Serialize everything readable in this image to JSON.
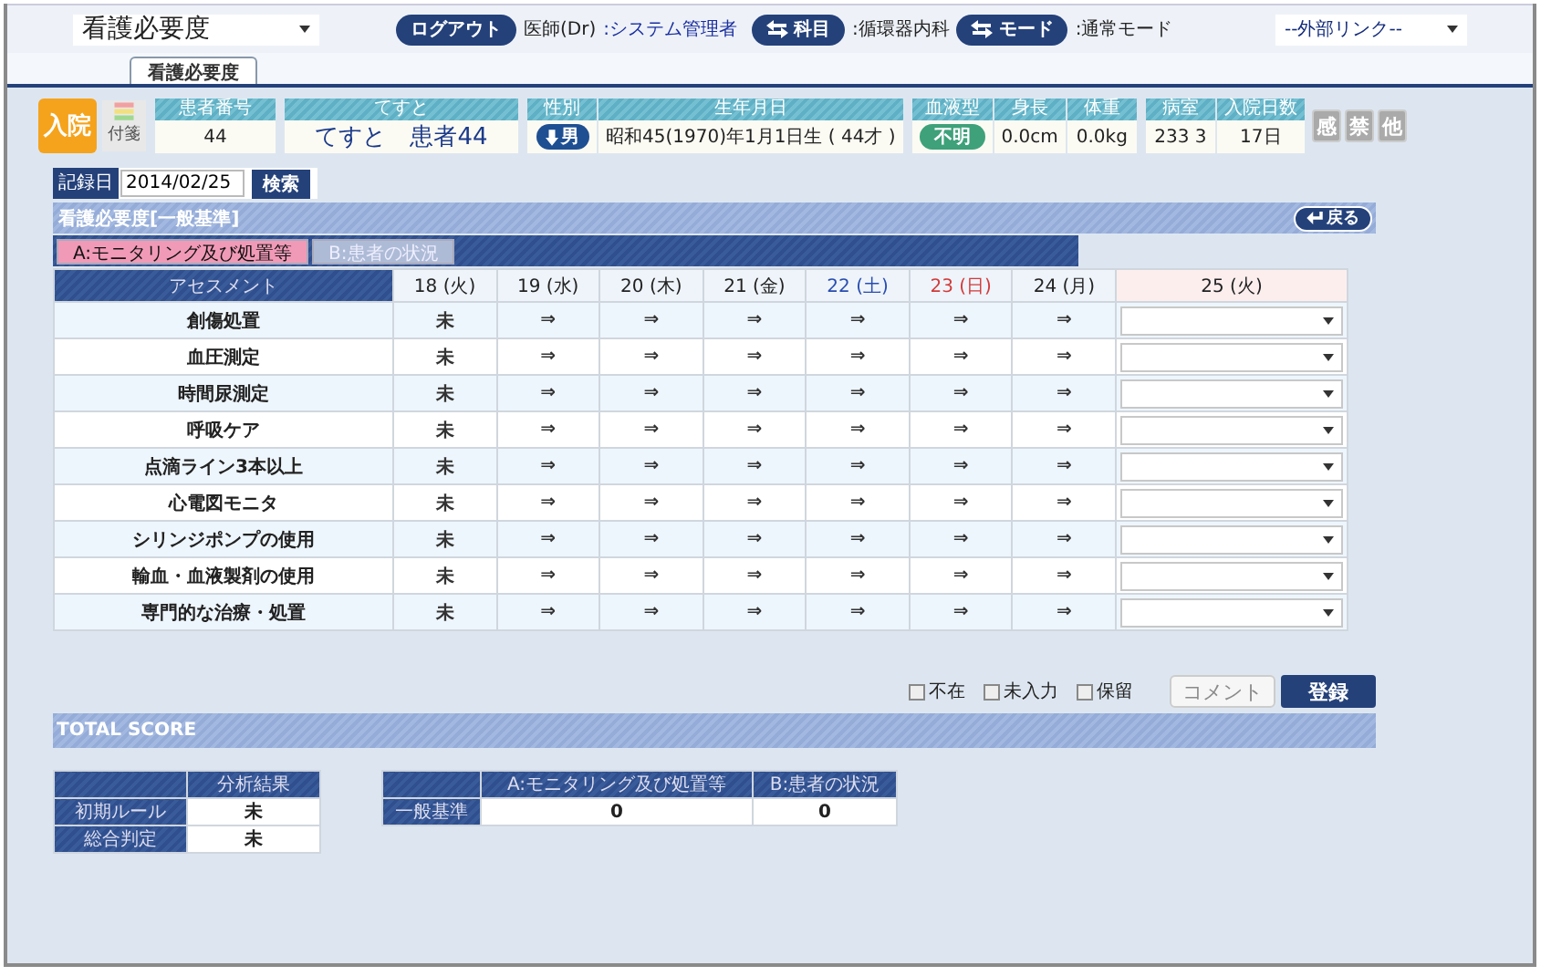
{
  "header": {
    "system_select": "看護必要度",
    "logout": "ログアウト",
    "user_label": "医師(Dr)",
    "user": ":システム管理者",
    "dept_button": "科目",
    "dept": ":循環器内科",
    "mode_button": "モード",
    "mode": ":通常モード",
    "link_select": "--外部リンク--"
  },
  "tabs": [
    {
      "label": "看護必要度",
      "selected": true
    }
  ],
  "patient": {
    "status": "入院",
    "sticky": "付箋",
    "groups": [
      [
        {
          "label": "患者番号",
          "value": "44",
          "kind": "text"
        }
      ],
      [
        {
          "label": "てすと",
          "value": "てすと　患者44",
          "kind": "name"
        }
      ],
      [
        {
          "label": "性別",
          "value": "男",
          "kind": "sex"
        },
        {
          "label": "生年月日",
          "value": "昭和45(1970)年1月1日生 ( 44才 )",
          "kind": "text"
        }
      ],
      [
        {
          "label": "血液型",
          "value": "不明",
          "kind": "blood"
        },
        {
          "label": "身長",
          "value": "0.0cm",
          "kind": "text"
        },
        {
          "label": "体重",
          "value": "0.0kg",
          "kind": "text"
        }
      ],
      [
        {
          "label": "病室",
          "value": "233 3",
          "kind": "text"
        },
        {
          "label": "入院日数",
          "value": "17日",
          "kind": "text"
        }
      ]
    ],
    "flags": [
      "感",
      "禁",
      "他"
    ]
  },
  "record": {
    "label": "記録日",
    "value": "2014/02/25",
    "button": "検索"
  },
  "section": {
    "title": "看護必要度[一般基準]",
    "back": "戻る"
  },
  "subtabs": [
    {
      "label": "A:モニタリング及び処置等",
      "selected": true
    },
    {
      "label": "B:患者の状況",
      "selected": false
    }
  ],
  "table": {
    "columns": [
      {
        "label": "アセスメント",
        "kind": "item"
      },
      {
        "label": "18 (火)",
        "kind": "weekday"
      },
      {
        "label": "19 (水)",
        "kind": "weekday"
      },
      {
        "label": "20 (木)",
        "kind": "weekday"
      },
      {
        "label": "21 (金)",
        "kind": "weekday"
      },
      {
        "label": "22 (土)",
        "kind": "saturday"
      },
      {
        "label": "23 (日)",
        "kind": "sunday"
      },
      {
        "label": "24 (月)",
        "kind": "weekday"
      },
      {
        "label": "25 (火)",
        "kind": "entry"
      }
    ],
    "rows": [
      {
        "cells": [
          "創傷処置",
          "未",
          "⇒",
          "⇒",
          "⇒",
          "⇒",
          "⇒",
          "⇒"
        ]
      },
      {
        "cells": [
          "血圧測定",
          "未",
          "⇒",
          "⇒",
          "⇒",
          "⇒",
          "⇒",
          "⇒"
        ]
      },
      {
        "cells": [
          "時間尿測定",
          "未",
          "⇒",
          "⇒",
          "⇒",
          "⇒",
          "⇒",
          "⇒"
        ]
      },
      {
        "cells": [
          "呼吸ケア",
          "未",
          "⇒",
          "⇒",
          "⇒",
          "⇒",
          "⇒",
          "⇒"
        ]
      },
      {
        "cells": [
          "点滴ライン3本以上",
          "未",
          "⇒",
          "⇒",
          "⇒",
          "⇒",
          "⇒",
          "⇒"
        ]
      },
      {
        "cells": [
          "心電図モニタ",
          "未",
          "⇒",
          "⇒",
          "⇒",
          "⇒",
          "⇒",
          "⇒"
        ]
      },
      {
        "cells": [
          "シリンジポンプの使用",
          "未",
          "⇒",
          "⇒",
          "⇒",
          "⇒",
          "⇒",
          "⇒"
        ]
      },
      {
        "cells": [
          "輸血・血液製剤の使用",
          "未",
          "⇒",
          "⇒",
          "⇒",
          "⇒",
          "⇒",
          "⇒"
        ]
      },
      {
        "cells": [
          "専門的な治療・処置",
          "未",
          "⇒",
          "⇒",
          "⇒",
          "⇒",
          "⇒",
          "⇒"
        ]
      }
    ]
  },
  "options": {
    "checkboxes": [
      {
        "label": "不在",
        "checked": false
      },
      {
        "label": "未入力",
        "checked": false
      },
      {
        "label": "保留",
        "checked": false
      }
    ],
    "comment": {
      "label": "コメント",
      "disabled": true
    },
    "submit": "登録"
  },
  "total": {
    "title": "TOTAL SCORE",
    "analysis": {
      "header": "分析結果",
      "rows": [
        {
          "label": "初期ルール",
          "value": "未"
        },
        {
          "label": "総合判定",
          "value": "未"
        }
      ]
    },
    "score": {
      "columns": [
        "A:モニタリング及び処置等",
        "B:患者の状況"
      ],
      "rows": [
        {
          "label": "一般基準",
          "values": [
            "0",
            "0"
          ]
        }
      ]
    }
  }
}
